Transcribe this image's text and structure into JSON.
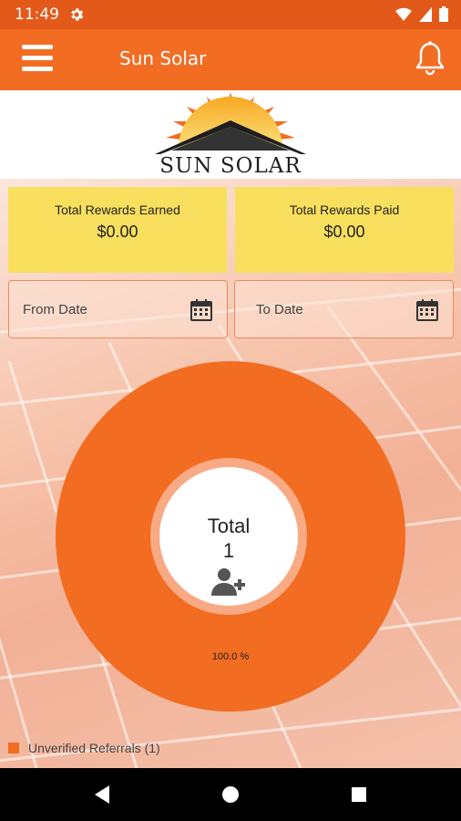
{
  "status_bar": {
    "time": "11:49",
    "icons": [
      "gear-icon",
      "wifi-icon",
      "signal-icon",
      "battery-icon"
    ]
  },
  "app_bar": {
    "title": "Sun Solar",
    "icons": [
      "menu-icon",
      "bell-icon"
    ]
  },
  "logo": {
    "text": "SUN SOLAR"
  },
  "rewards": {
    "earned_label": "Total Rewards Earned",
    "earned_value": "$0.00",
    "paid_label": "Total Rewards Paid",
    "paid_value": "$0.00"
  },
  "date_filter": {
    "from_label": "From Date",
    "to_label": "To Date"
  },
  "chart_data": {
    "type": "pie",
    "categories": [
      "Unverified Referrals (1)"
    ],
    "values": [
      1
    ],
    "slice_labels": [
      "100.0 %"
    ],
    "center_label": "Total",
    "center_value": "1",
    "legend_position": "bottom-left"
  },
  "colors": {
    "accent": "#f26c22",
    "status_bar": "#e3591a",
    "card": "#f8e05e"
  },
  "nav": {
    "icons": [
      "back-icon",
      "home-icon",
      "recents-icon"
    ]
  }
}
